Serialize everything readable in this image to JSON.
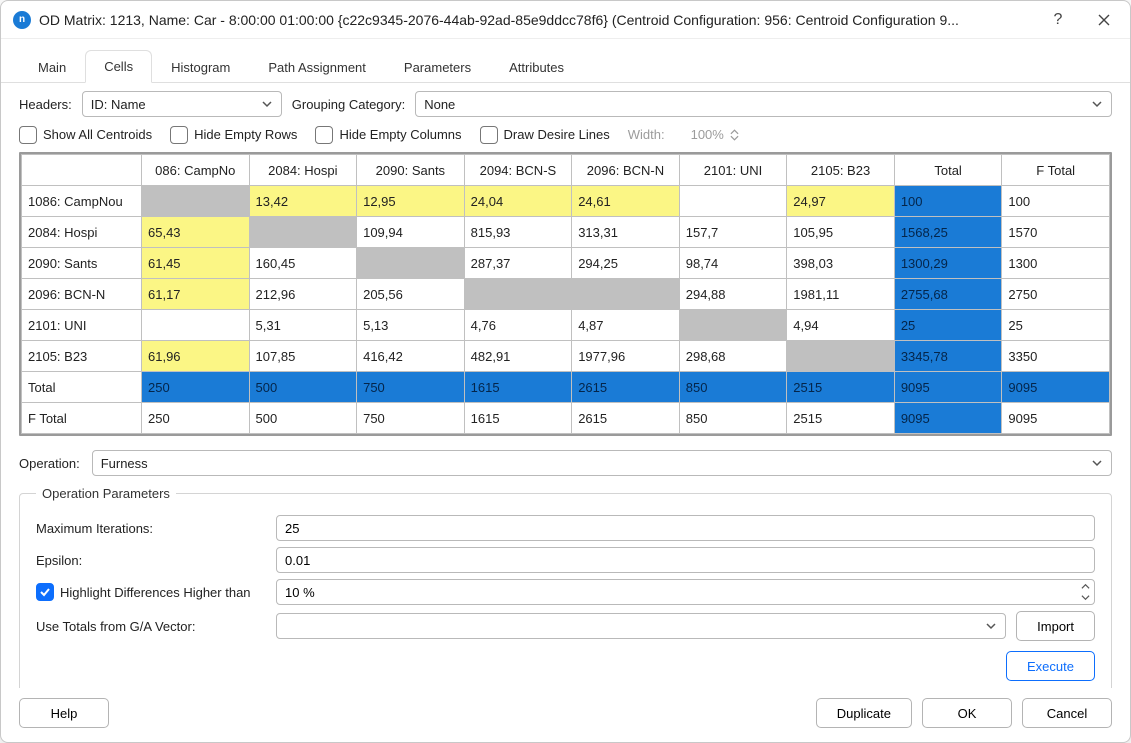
{
  "window": {
    "title": "OD Matrix: 1213, Name: Car - 8:00:00 01:00:00  {c22c9345-2076-44ab-92ad-85e9ddcc78f6} (Centroid Configuration: 956: Centroid Configuration 9...",
    "help_glyph": "?"
  },
  "tabs": [
    "Main",
    "Cells",
    "Histogram",
    "Path Assignment",
    "Parameters",
    "Attributes"
  ],
  "active_tab": "Cells",
  "headers": {
    "label": "Headers:",
    "value": "ID: Name"
  },
  "grouping": {
    "label": "Grouping Category:",
    "value": "None"
  },
  "options": {
    "show_all_centroids": "Show All Centroids",
    "hide_empty_rows": "Hide Empty Rows",
    "hide_empty_cols": "Hide Empty Columns",
    "draw_desire_lines": "Draw Desire Lines",
    "width_label": "Width:",
    "width_value": "100%"
  },
  "matrix": {
    "col_headers": [
      "086: CampNo",
      "2084: Hospi",
      "2090: Sants",
      "2094: BCN-S",
      "2096: BCN-N",
      "2101: UNI",
      "2105: B23",
      "Total",
      "F Total"
    ],
    "row_headers": [
      "1086: CampNou",
      "2084: Hospi",
      "2090: Sants",
      "2096: BCN-N",
      "2101: UNI",
      "2105: B23",
      "Total",
      "F Total"
    ],
    "cells": [
      [
        {
          "v": "",
          "c": "gray"
        },
        {
          "v": "13,42",
          "c": "yellow"
        },
        {
          "v": "12,95",
          "c": "yellow"
        },
        {
          "v": "24,04",
          "c": "yellow"
        },
        {
          "v": "24,61",
          "c": "yellow"
        },
        {
          "v": "",
          "c": ""
        },
        {
          "v": "24,97",
          "c": "yellow"
        },
        {
          "v": "100",
          "c": "blue"
        },
        {
          "v": "100",
          "c": ""
        }
      ],
      [
        {
          "v": "65,43",
          "c": "yellow"
        },
        {
          "v": "",
          "c": "gray"
        },
        {
          "v": "109,94",
          "c": ""
        },
        {
          "v": "815,93",
          "c": ""
        },
        {
          "v": "313,31",
          "c": ""
        },
        {
          "v": "157,7",
          "c": ""
        },
        {
          "v": "105,95",
          "c": ""
        },
        {
          "v": "1568,25",
          "c": "blue"
        },
        {
          "v": "1570",
          "c": ""
        }
      ],
      [
        {
          "v": "61,45",
          "c": "yellow"
        },
        {
          "v": "160,45",
          "c": ""
        },
        {
          "v": "",
          "c": "gray"
        },
        {
          "v": "287,37",
          "c": ""
        },
        {
          "v": "294,25",
          "c": ""
        },
        {
          "v": "98,74",
          "c": ""
        },
        {
          "v": "398,03",
          "c": ""
        },
        {
          "v": "1300,29",
          "c": "blue"
        },
        {
          "v": "1300",
          "c": ""
        }
      ],
      [
        {
          "v": "61,17",
          "c": "yellow"
        },
        {
          "v": "212,96",
          "c": ""
        },
        {
          "v": "205,56",
          "c": ""
        },
        {
          "v": "",
          "c": "gray"
        },
        {
          "v": "",
          "c": "gray"
        },
        {
          "v": "294,88",
          "c": ""
        },
        {
          "v": "1981,11",
          "c": ""
        },
        {
          "v": "2755,68",
          "c": "blue"
        },
        {
          "v": "2750",
          "c": ""
        }
      ],
      [
        {
          "v": "",
          "c": ""
        },
        {
          "v": "5,31",
          "c": ""
        },
        {
          "v": "5,13",
          "c": ""
        },
        {
          "v": "4,76",
          "c": ""
        },
        {
          "v": "4,87",
          "c": ""
        },
        {
          "v": "",
          "c": "gray"
        },
        {
          "v": "4,94",
          "c": ""
        },
        {
          "v": "25",
          "c": "blue"
        },
        {
          "v": "25",
          "c": ""
        }
      ],
      [
        {
          "v": "61,96",
          "c": "yellow"
        },
        {
          "v": "107,85",
          "c": ""
        },
        {
          "v": "416,42",
          "c": ""
        },
        {
          "v": "482,91",
          "c": ""
        },
        {
          "v": "1977,96",
          "c": ""
        },
        {
          "v": "298,68",
          "c": ""
        },
        {
          "v": "",
          "c": "gray"
        },
        {
          "v": "3345,78",
          "c": "blue"
        },
        {
          "v": "3350",
          "c": ""
        }
      ],
      [
        {
          "v": "250",
          "c": "blue"
        },
        {
          "v": "500",
          "c": "blue"
        },
        {
          "v": "750",
          "c": "blue"
        },
        {
          "v": "1615",
          "c": "blue"
        },
        {
          "v": "2615",
          "c": "blue"
        },
        {
          "v": "850",
          "c": "blue"
        },
        {
          "v": "2515",
          "c": "blue"
        },
        {
          "v": "9095",
          "c": "blue"
        },
        {
          "v": "9095",
          "c": "blue"
        }
      ],
      [
        {
          "v": "250",
          "c": ""
        },
        {
          "v": "500",
          "c": ""
        },
        {
          "v": "750",
          "c": ""
        },
        {
          "v": "1615",
          "c": ""
        },
        {
          "v": "2615",
          "c": ""
        },
        {
          "v": "850",
          "c": ""
        },
        {
          "v": "2515",
          "c": ""
        },
        {
          "v": "9095",
          "c": "blue"
        },
        {
          "v": "9095",
          "c": ""
        }
      ]
    ]
  },
  "operation": {
    "label": "Operation:",
    "value": "Furness"
  },
  "op_params": {
    "legend": "Operation Parameters",
    "max_iter_label": "Maximum Iterations:",
    "max_iter": "25",
    "epsilon_label": "Epsilon:",
    "epsilon": "0.01",
    "highlight_label": "Highlight Differences Higher than",
    "highlight_value": "10 %",
    "use_totals_label": "Use Totals from G/A Vector:",
    "use_totals_value": "",
    "import": "Import",
    "execute": "Execute"
  },
  "footer": {
    "help": "Help",
    "duplicate": "Duplicate",
    "ok": "OK",
    "cancel": "Cancel"
  }
}
